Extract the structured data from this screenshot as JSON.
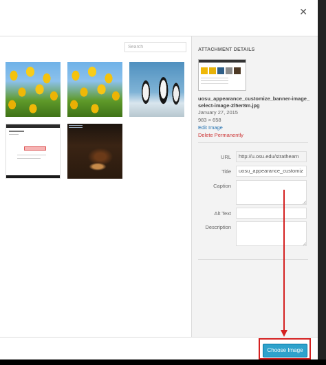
{
  "search": {
    "placeholder": "Search"
  },
  "sidebar": {
    "title": "ATTACHMENT DETAILS",
    "filename": "uosu_appearance_customize_banner-image_select-image-2l5er8m.jpg",
    "date": "January 27, 2015",
    "dimensions": "983 × 658",
    "edit_link": "Edit Image",
    "delete_link": "Delete Permanently",
    "fields": {
      "url_label": "URL",
      "url_value": "http://u.osu.edu/strathearn",
      "title_label": "Title",
      "title_value": "uosu_appearance_customiz",
      "caption_label": "Caption",
      "caption_value": "",
      "alt_label": "Alt Text",
      "alt_value": "",
      "description_label": "Description",
      "description_value": ""
    }
  },
  "footer": {
    "choose_label": "Choose Image"
  },
  "icons": {
    "close": "close-icon"
  },
  "colors": {
    "accent": "#2ea2cc",
    "annotation": "#d42020",
    "delete": "#cc3333",
    "link": "#2271b1"
  },
  "media": [
    {
      "name": "yellow-tulips-image"
    },
    {
      "name": "yellow-tulips-image"
    },
    {
      "name": "penguins-image"
    },
    {
      "name": "screenshot-image"
    },
    {
      "name": "dark-room-image"
    }
  ]
}
